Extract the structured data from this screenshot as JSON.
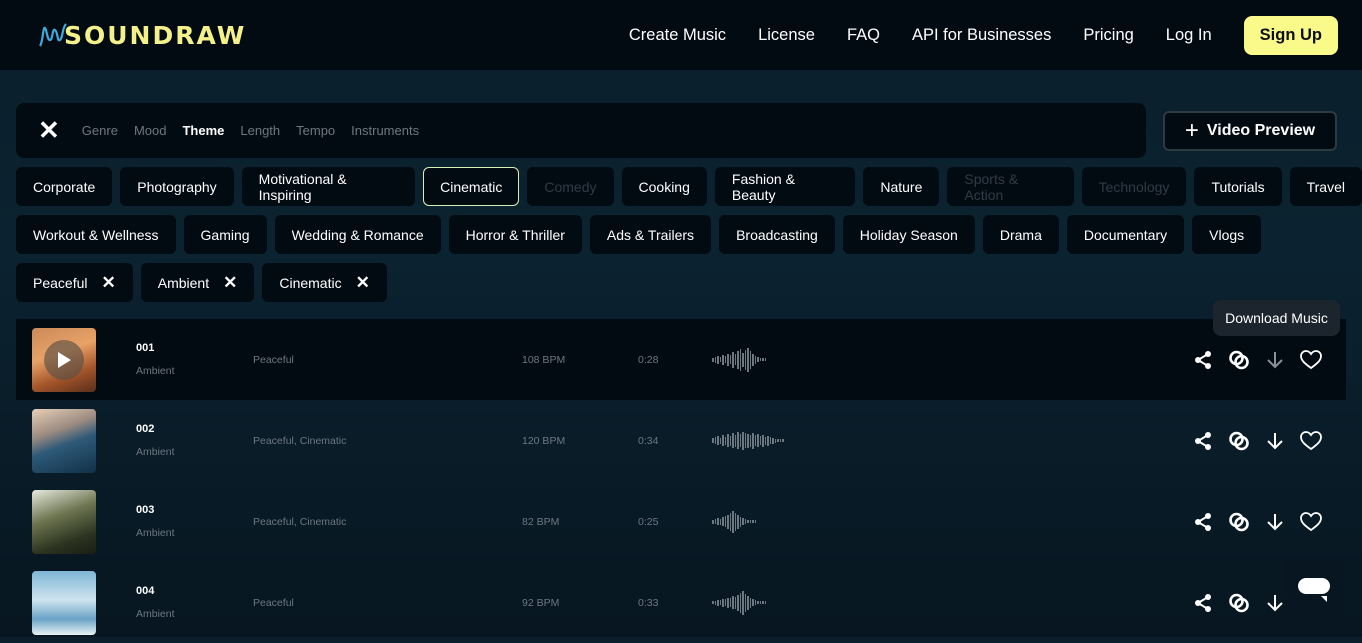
{
  "nav": {
    "logo": "SOUNDRAW",
    "links": [
      "Create Music",
      "License",
      "FAQ",
      "API for Businesses",
      "Pricing",
      "Log In"
    ],
    "signup": "Sign Up"
  },
  "filters": {
    "tabs": [
      "Genre",
      "Mood",
      "Theme",
      "Length",
      "Tempo",
      "Instruments"
    ],
    "active": "Theme",
    "video_preview": "Video Preview"
  },
  "themes": {
    "row1": [
      {
        "label": "Corporate"
      },
      {
        "label": "Photography"
      },
      {
        "label": "Motivational & Inspiring"
      },
      {
        "label": "Cinematic",
        "selected": true
      },
      {
        "label": "Comedy",
        "disabled": true
      },
      {
        "label": "Cooking"
      },
      {
        "label": "Fashion & Beauty"
      },
      {
        "label": "Nature"
      },
      {
        "label": "Sports & Action",
        "disabled": true
      },
      {
        "label": "Technology",
        "disabled": true
      },
      {
        "label": "Tutorials"
      },
      {
        "label": "Travel"
      }
    ],
    "row2": [
      {
        "label": "Workout & Wellness"
      },
      {
        "label": "Gaming"
      },
      {
        "label": "Wedding & Romance"
      },
      {
        "label": "Horror & Thriller"
      },
      {
        "label": "Ads & Trailers"
      },
      {
        "label": "Broadcasting"
      },
      {
        "label": "Holiday Season"
      },
      {
        "label": "Drama"
      },
      {
        "label": "Documentary"
      },
      {
        "label": "Vlogs"
      }
    ]
  },
  "active_filters": [
    "Peaceful",
    "Ambient",
    "Cinematic"
  ],
  "tooltip": "Download Music",
  "tracks": [
    {
      "title": "001",
      "genre": "Ambient",
      "tags": "Peaceful",
      "bpm": "108 BPM",
      "duration": "0:28"
    },
    {
      "title": "002",
      "genre": "Ambient",
      "tags": "Peaceful, Cinematic",
      "bpm": "120 BPM",
      "duration": "0:34"
    },
    {
      "title": "003",
      "genre": "Ambient",
      "tags": "Peaceful, Cinematic",
      "bpm": "82 BPM",
      "duration": "0:25"
    },
    {
      "title": "004",
      "genre": "Ambient",
      "tags": "Peaceful",
      "bpm": "92 BPM",
      "duration": "0:33"
    }
  ],
  "colors": {
    "accent": "#fafa8a",
    "background": "#0b2230",
    "panel": "#030b12"
  }
}
